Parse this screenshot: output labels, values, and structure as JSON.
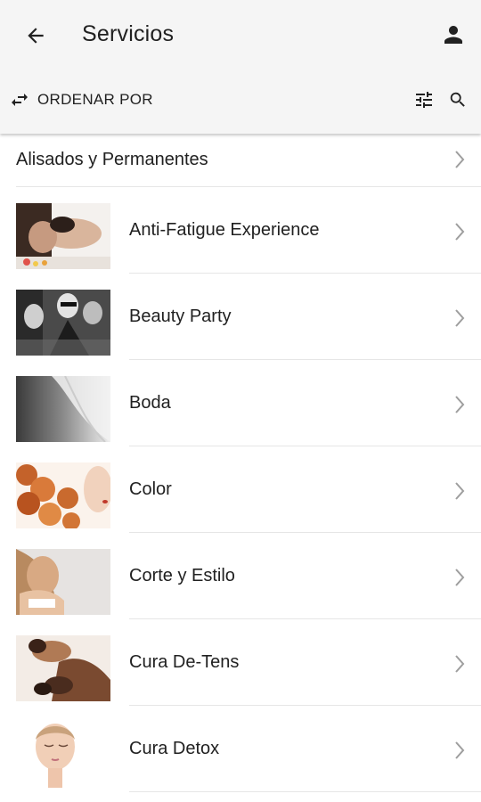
{
  "appbar": {
    "title": "Servicios",
    "back_icon": "arrow-back-icon",
    "account_icon": "person-icon"
  },
  "toolbar": {
    "sort_label": "ORDENAR POR",
    "sort_icon": "swap-arrows-icon",
    "filter_icon": "tune-sliders-icon",
    "search_icon": "search-icon"
  },
  "list": {
    "header_item": {
      "label": "Alisados y Permanentes"
    },
    "items": [
      {
        "label": "Anti-Fatigue Experience",
        "image": "massage-face-photo"
      },
      {
        "label": "Beauty Party",
        "image": "party-group-photo"
      },
      {
        "label": "Boda",
        "image": "bridal-veil-photo"
      },
      {
        "label": "Color",
        "image": "curly-red-hair-photo"
      },
      {
        "label": "Corte y Estilo",
        "image": "woman-hair-style-photo"
      },
      {
        "label": "Cura De-Tens",
        "image": "hot-stone-massage-photo"
      },
      {
        "label": "Cura Detox",
        "image": "woman-face-closed-eyes-photo"
      }
    ]
  },
  "colors": {
    "appbar_bg": "#f5f5f5",
    "text": "#212121",
    "chevron": "#9e9e9e",
    "divider": "#e6e6e6"
  }
}
